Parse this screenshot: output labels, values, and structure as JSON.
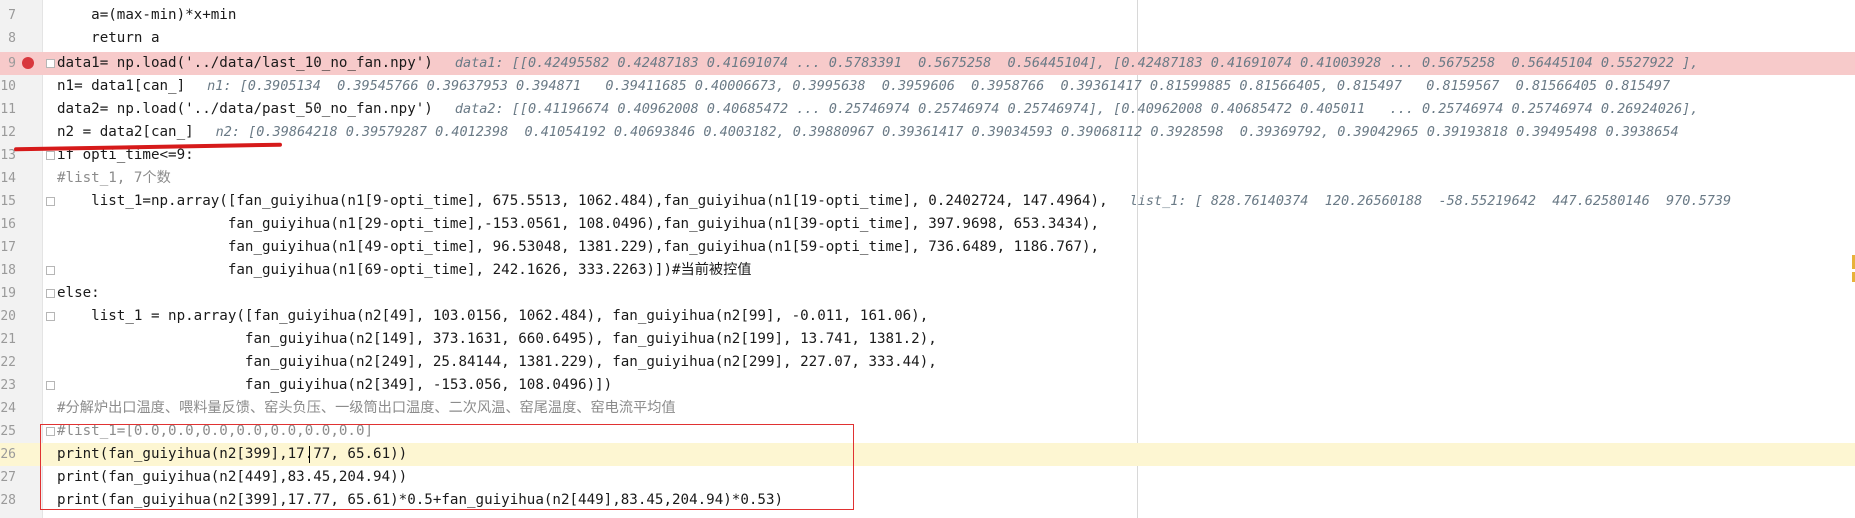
{
  "lines": [
    {
      "num": "7",
      "code": "    a=(max-min)*x+min",
      "hint": ""
    },
    {
      "num": "8",
      "code": "    return a",
      "hint": ""
    },
    {
      "num": "9",
      "code": "data1= np.load('../data/last_10_no_fan.npy')",
      "hint": "data1: [[0.42495582 0.42487183 0.41691074 ... 0.5783391  0.5675258  0.56445104], [0.42487183 0.41691074 0.41003928 ... 0.5675258  0.56445104 0.5527922 ],"
    },
    {
      "num": "10",
      "code": "n1= data1[can_]",
      "hint": "n1: [0.3905134  0.39545766 0.39637953 0.394871   0.39411685 0.40006673, 0.3995638  0.3959606  0.3958766  0.39361417 0.81599885 0.81566405, 0.815497   0.8159567  0.81566405 0.815497"
    },
    {
      "num": "11",
      "code": "data2= np.load('../data/past_50_no_fan.npy')",
      "hint": "data2: [[0.41196674 0.40962008 0.40685472 ... 0.25746974 0.25746974 0.25746974], [0.40962008 0.40685472 0.405011   ... 0.25746974 0.25746974 0.26924026],"
    },
    {
      "num": "12",
      "code": "n2 = data2[can_]",
      "hint": "n2: [0.39864218 0.39579287 0.4012398  0.41054192 0.40693846 0.4003182, 0.39880967 0.39361417 0.39034593 0.39068112 0.3928598  0.39369792, 0.39042965 0.39193818 0.39495498 0.3938654"
    },
    {
      "num": "13",
      "code": "if opti_time<=9:",
      "hint": ""
    },
    {
      "num": "14",
      "code": "#list_1, 7个数",
      "hint": ""
    },
    {
      "num": "15",
      "code": "    list_1=np.array([fan_guiyihua(n1[9-opti_time], 675.5513, 1062.484),fan_guiyihua(n1[19-opti_time], 0.2402724, 147.4964),",
      "hint": "list_1: [ 828.76140374  120.26560188  -58.55219642  447.62580146  970.5739"
    },
    {
      "num": "16",
      "code": "                    fan_guiyihua(n1[29-opti_time],-153.0561, 108.0496),fan_guiyihua(n1[39-opti_time], 397.9698, 653.3434),",
      "hint": ""
    },
    {
      "num": "17",
      "code": "                    fan_guiyihua(n1[49-opti_time], 96.53048, 1381.229),fan_guiyihua(n1[59-opti_time], 736.6489, 1186.767),",
      "hint": ""
    },
    {
      "num": "18",
      "code": "                    fan_guiyihua(n1[69-opti_time], 242.1626, 333.2263)])#当前被控值",
      "hint": ""
    },
    {
      "num": "19",
      "code": "else:",
      "hint": ""
    },
    {
      "num": "20",
      "code": "    list_1 = np.array([fan_guiyihua(n2[49], 103.0156, 1062.484), fan_guiyihua(n2[99], -0.011, 161.06),",
      "hint": ""
    },
    {
      "num": "21",
      "code": "                      fan_guiyihua(n2[149], 373.1631, 660.6495), fan_guiyihua(n2[199], 13.741, 1381.2),",
      "hint": ""
    },
    {
      "num": "22",
      "code": "                      fan_guiyihua(n2[249], 25.84144, 1381.229), fan_guiyihua(n2[299], 227.07, 333.44),",
      "hint": ""
    },
    {
      "num": "23",
      "code": "                      fan_guiyihua(n2[349], -153.056, 108.0496)])",
      "hint": ""
    },
    {
      "num": "24",
      "code": "#分解炉出口温度、喂料量反馈、窑头负压、一级筒出口温度、二次风温、窑尾温度、窑电流平均值",
      "hint": ""
    },
    {
      "num": "25",
      "code": "#list_1=[0.0,0.0,0.0,0.0,0.0,0.0,0.0]",
      "hint": ""
    },
    {
      "num": "26",
      "code": "print(fan_guiyihua(n2[399],17.77, 65.61))",
      "hint": ""
    },
    {
      "num": "27",
      "code": "print(fan_guiyihua(n2[449],83.45,204.94))",
      "hint": ""
    },
    {
      "num": "28",
      "code": "print(fan_guiyihua(n2[399],17.77, 65.61)*0.5+fan_guiyihua(n2[449],83.45,204.94)*0.53)",
      "hint": ""
    }
  ],
  "colors": {
    "breakpoint_line": "#f7caca",
    "current_line": "#fdf6d2",
    "annotation_red": "#e03232"
  },
  "icons": [
    "breakpoint-icon",
    "fold-marker-icon"
  ]
}
